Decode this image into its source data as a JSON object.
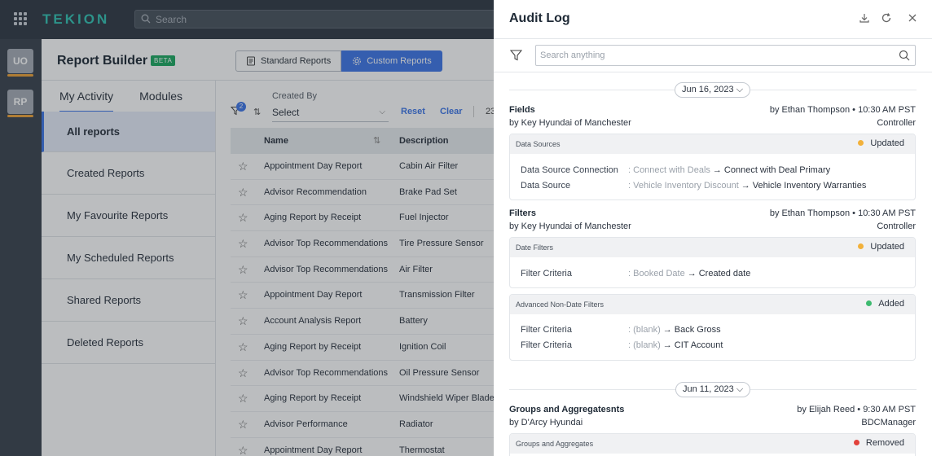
{
  "topbar": {
    "brand": "TEKION",
    "search_placeholder": "Search"
  },
  "rail": {
    "items": [
      "UO",
      "RP"
    ]
  },
  "report_builder": {
    "title": "Report Builder",
    "badge": "BETA",
    "tabs": [
      {
        "label": "Standard Reports",
        "active": false
      },
      {
        "label": "Custom Reports",
        "active": true
      }
    ],
    "activity_tabs": [
      {
        "label": "My Activity",
        "active": true
      },
      {
        "label": "Modules",
        "active": false
      }
    ],
    "sidebar": [
      {
        "label": "All reports",
        "active": true
      },
      {
        "label": "Created Reports",
        "active": false
      },
      {
        "label": "My Favourite Reports",
        "active": false
      },
      {
        "label": "My Scheduled Reports",
        "active": false
      },
      {
        "label": "Shared Reports",
        "active": false
      },
      {
        "label": "Deleted Reports",
        "active": false
      }
    ],
    "filters": {
      "badge_count": "2",
      "created_by_label": "Created By",
      "created_by_value": "Select",
      "reset": "Reset",
      "clear": "Clear",
      "count_partial": "23"
    },
    "table": {
      "columns": [
        "Name",
        "Description"
      ],
      "rows": [
        {
          "name": "Appointment Day Report",
          "description": "Cabin Air Filter"
        },
        {
          "name": "Advisor Recommendation",
          "description": "Brake Pad Set"
        },
        {
          "name": "Aging Report by Receipt",
          "description": "Fuel Injector"
        },
        {
          "name": "Advisor Top Recommendations",
          "description": "Tire Pressure Sensor"
        },
        {
          "name": "Advisor Top Recommendations",
          "description": "Air Filter"
        },
        {
          "name": "Appointment Day Report",
          "description": "Transmission Filter"
        },
        {
          "name": "Account Analysis Report",
          "description": "Battery"
        },
        {
          "name": "Aging Report by Receipt",
          "description": "Ignition Coil"
        },
        {
          "name": "Advisor Top Recommendations",
          "description": "Oil Pressure Sensor"
        },
        {
          "name": "Aging Report by Receipt",
          "description": "Windshield Wiper Blade"
        },
        {
          "name": "Advisor Performance",
          "description": "Radiator"
        },
        {
          "name": "Appointment Day Report",
          "description": "Thermostat"
        }
      ]
    }
  },
  "audit_log": {
    "title": "Audit Log",
    "search_placeholder": "Search anything",
    "groups": [
      {
        "date": "Jun 16, 2023",
        "entries": [
          {
            "title": "Fields",
            "by": "by Ethan Thompson • 10:30 AM PST",
            "dealer": "by Key Hyundai of Manchester",
            "role": "Controller",
            "cards": [
              {
                "section": "Data Sources",
                "status": "Updated",
                "status_color": "#f2b13a",
                "changes": [
                  {
                    "key": "Data Source Connection",
                    "old": "Connect with Deals",
                    "new": "Connect with Deal Primary"
                  },
                  {
                    "key": "Data Source",
                    "old": "Vehicle Inventory Discount",
                    "new": "Vehicle Inventory Warranties"
                  }
                ]
              }
            ]
          },
          {
            "title": "Filters",
            "by": "by Ethan Thompson • 10:30 AM PST",
            "dealer": "by Key Hyundai of Manchester",
            "role": "Controller",
            "cards": [
              {
                "section": "Date Filters",
                "status": "Updated",
                "status_color": "#f2b13a",
                "changes": [
                  {
                    "key": "Filter Criteria",
                    "old": "Booked Date",
                    "new": "Created date"
                  }
                ]
              },
              {
                "section": "Advanced Non-Date Filters",
                "status": "Added",
                "status_color": "#3dba6f",
                "changes": [
                  {
                    "key": "Filter Criteria",
                    "old": "(blank)",
                    "new": "Back Gross"
                  },
                  {
                    "key": "Filter Criteria",
                    "old": "(blank)",
                    "new": "CIT Account"
                  }
                ]
              }
            ]
          }
        ]
      },
      {
        "date": "Jun 11, 2023",
        "entries": [
          {
            "title": "Groups and Aggregatesnts",
            "by": "by Elijah Reed • 9:30 AM PST",
            "dealer": "by D'Arcy Hyundai",
            "role": "BDCManager",
            "cards": [
              {
                "section": "Groups and Aggregates",
                "status": "Removed",
                "status_color": "#e2423b",
                "changes": []
              }
            ]
          }
        ]
      }
    ]
  }
}
